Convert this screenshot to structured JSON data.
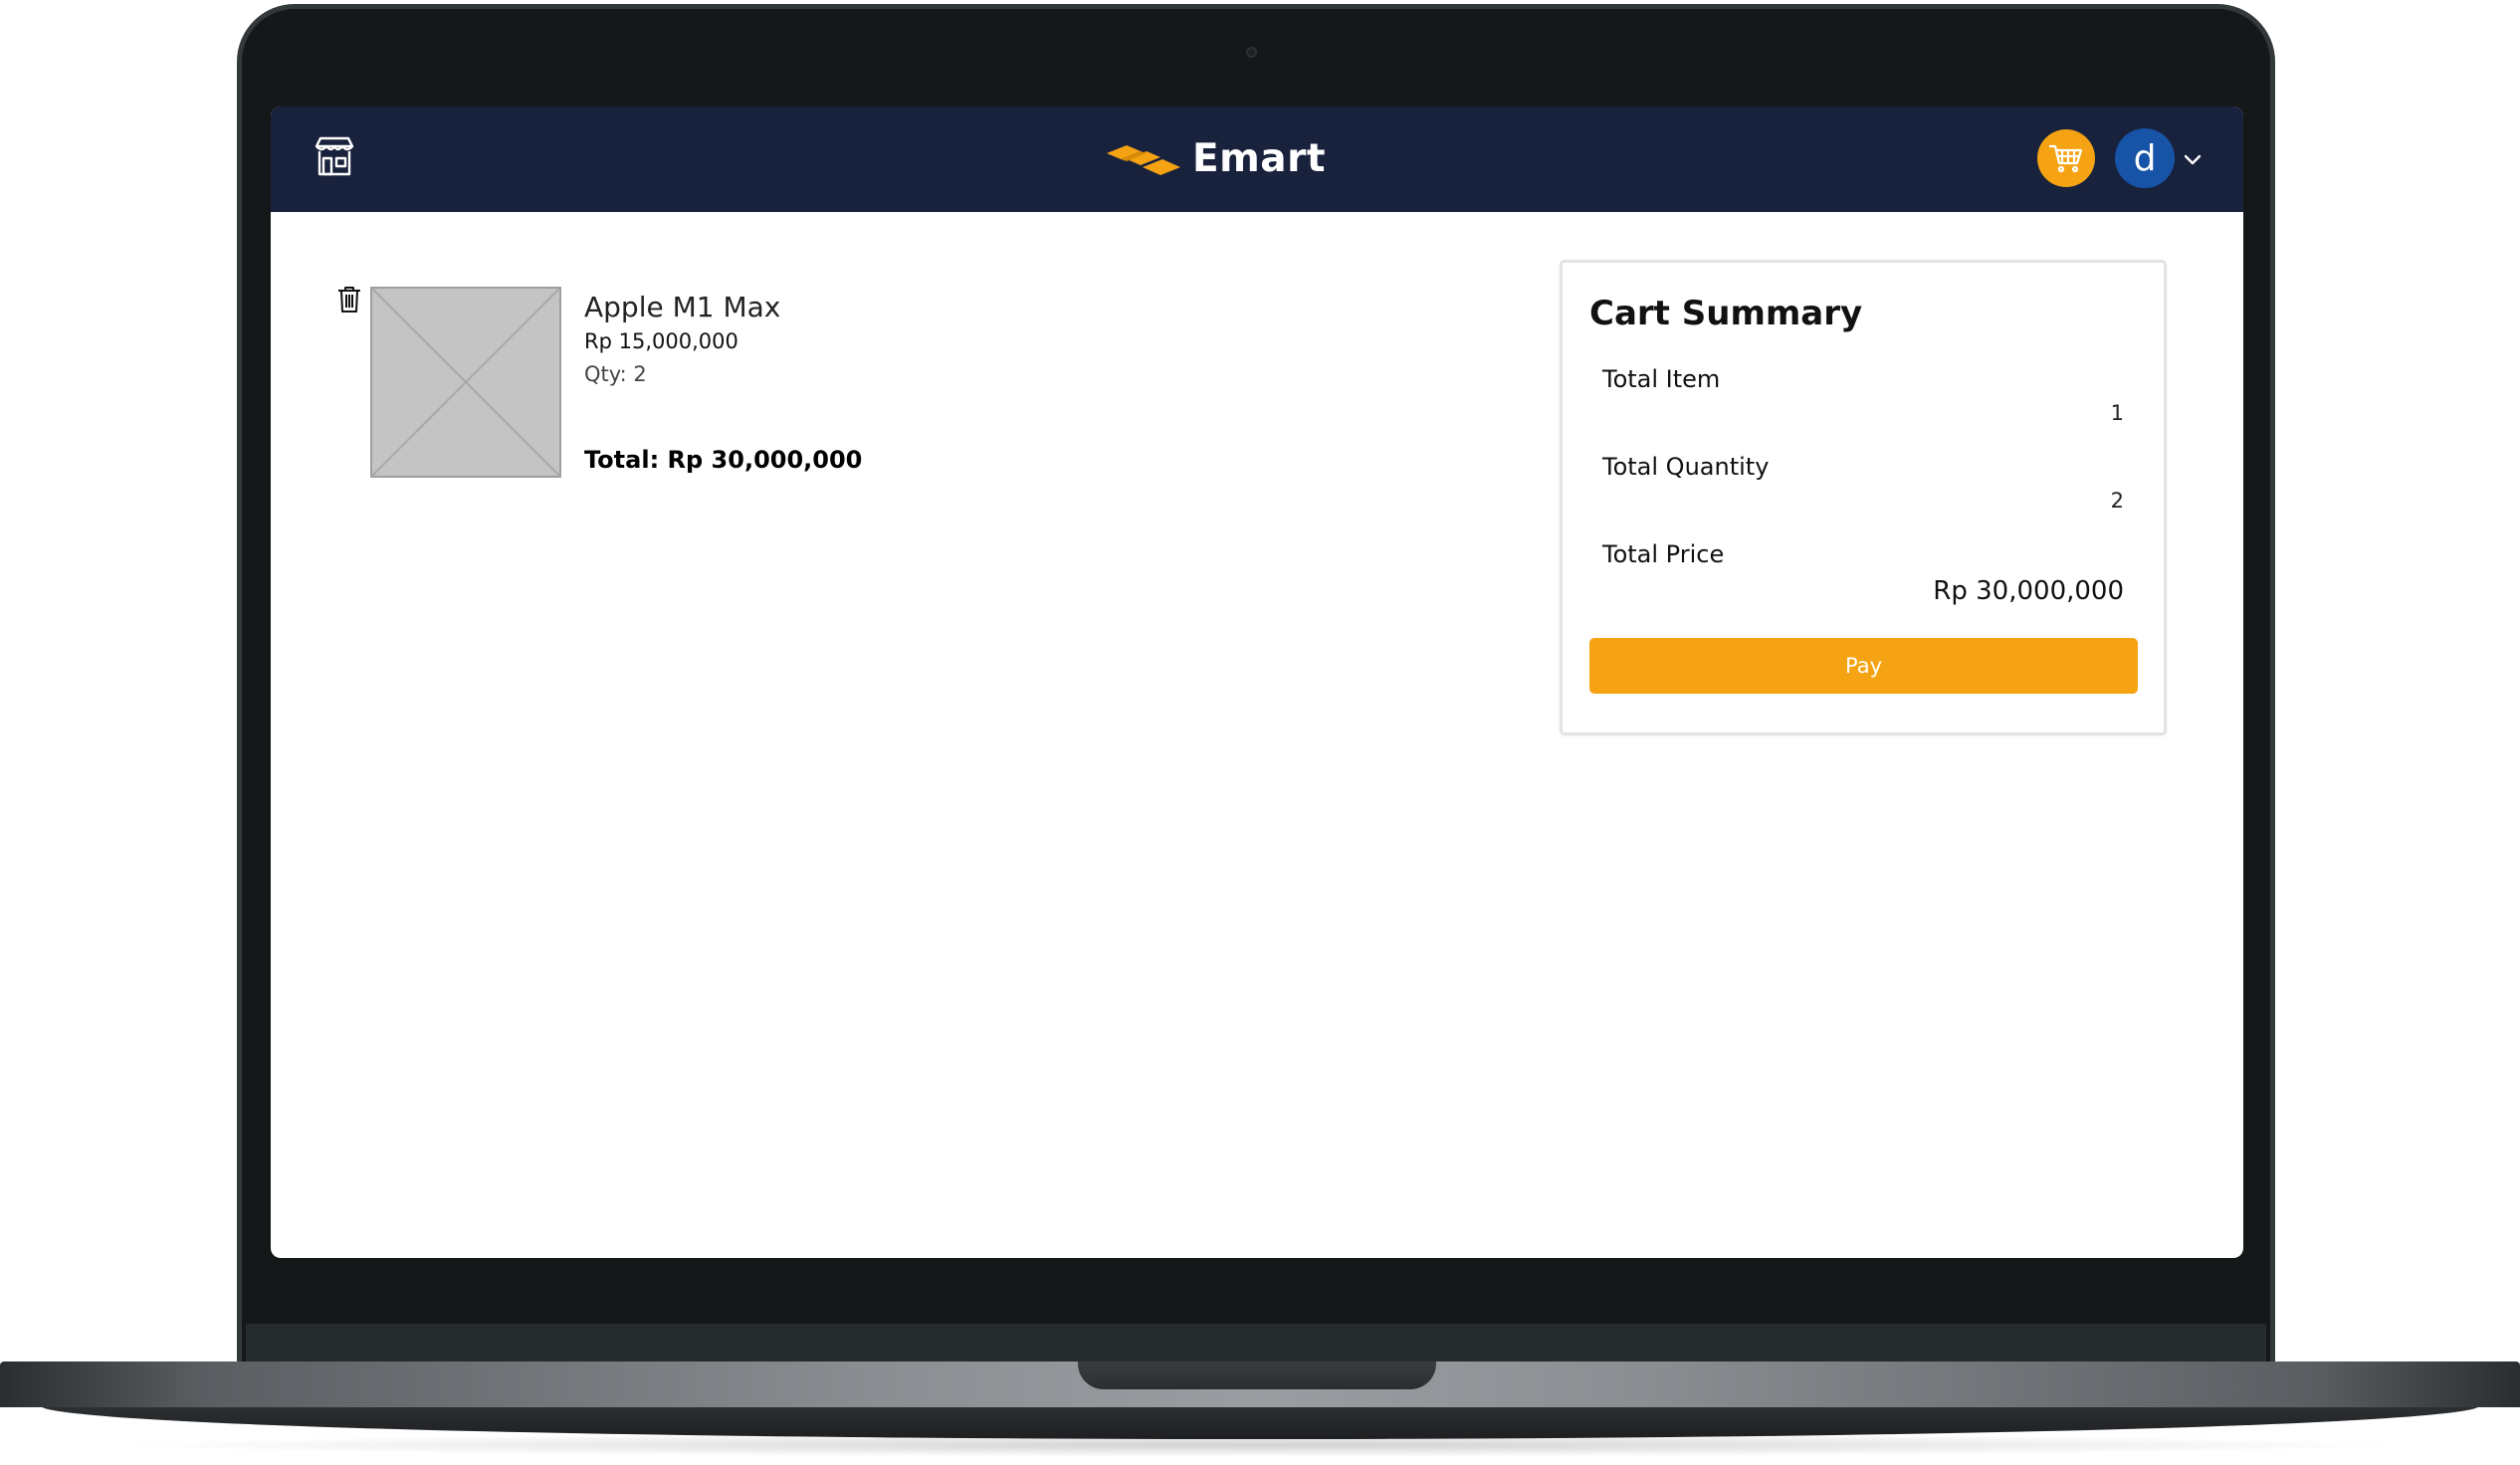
{
  "header": {
    "brand_name": "Emart",
    "user_initial": "d",
    "icons": {
      "store": "store-icon",
      "cart": "shopping-cart-icon",
      "chevron": "chevron-down-icon",
      "logo": "emart-logo-icon"
    }
  },
  "cart": {
    "items": [
      {
        "name": "Apple M1 Max",
        "price": "Rp 15,000,000",
        "qty": "Qty: 2",
        "total_label": "Total:",
        "total_value": "Rp 30,000,000"
      }
    ]
  },
  "summary": {
    "title": "Cart Summary",
    "total_item_label": "Total Item",
    "total_item_value": "1",
    "total_quantity_label": "Total Quantity",
    "total_quantity_value": "2",
    "total_price_label": "Total Price",
    "total_price_value": "Rp 30,000,000",
    "pay_label": "Pay"
  },
  "colors": {
    "navbar": "#19223d",
    "accent": "#f6a313",
    "avatar": "#1753a6",
    "laptop_bezel": "#151819"
  }
}
